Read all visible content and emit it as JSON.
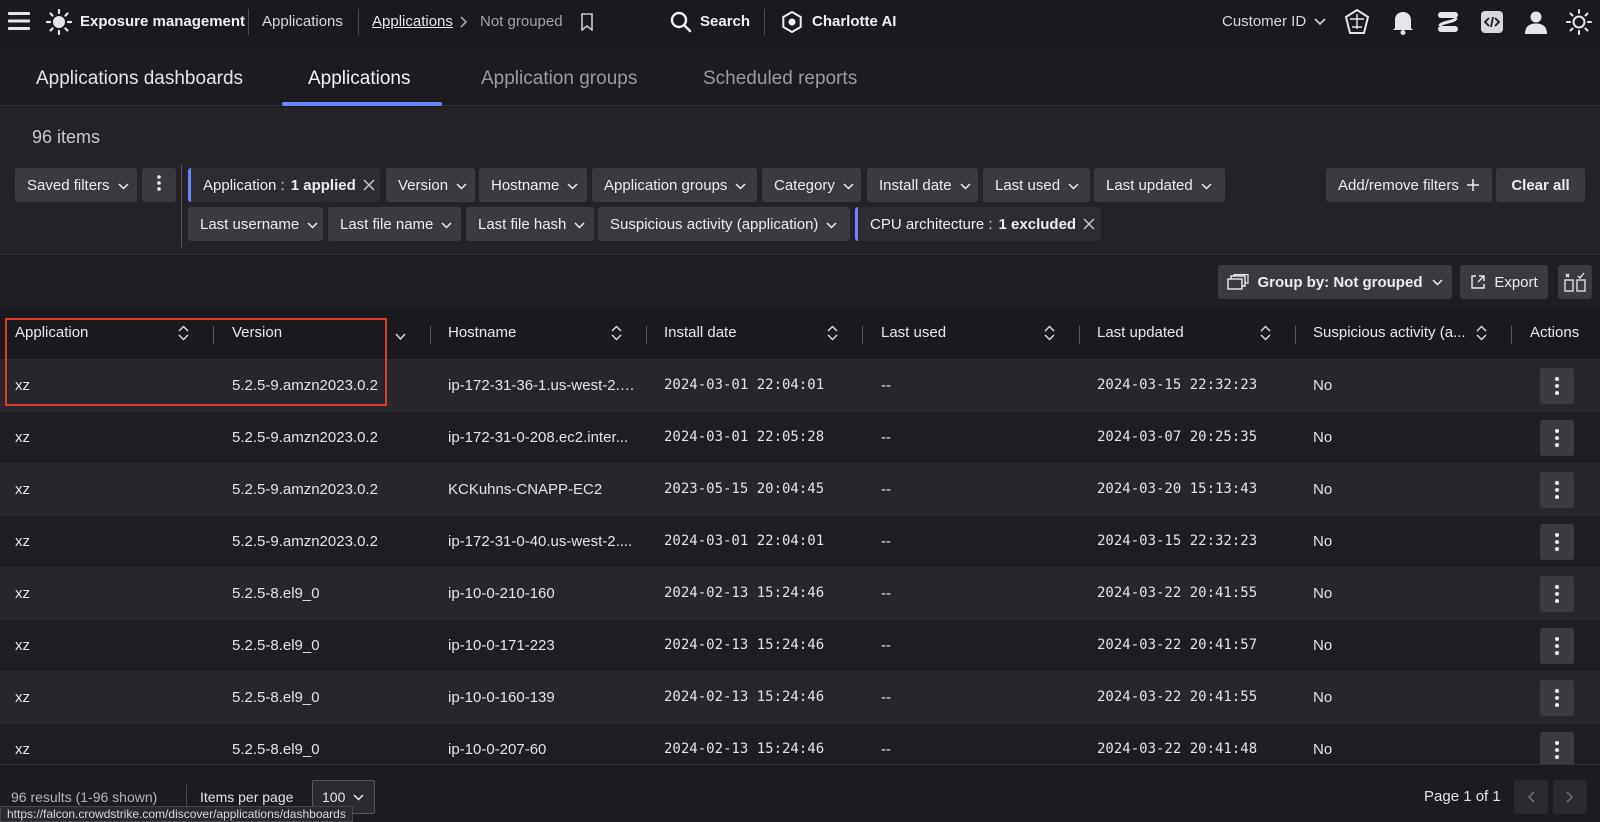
{
  "topbar": {
    "brand": "Exposure management",
    "crumbs": [
      "Applications",
      "Applications",
      "Not grouped"
    ],
    "search": "Search",
    "charlotte": "Charlotte AI",
    "customer": "Customer ID"
  },
  "tabs": [
    "Applications dashboards",
    "Applications",
    "Application groups",
    "Scheduled reports"
  ],
  "filters": {
    "count": "96 items",
    "saved": "Saved filters",
    "application_label": "Application :",
    "application_value": "1 applied",
    "row1": [
      "Version",
      "Hostname",
      "Application groups",
      "Category",
      "Install date",
      "Last used",
      "Last updated"
    ],
    "row2": [
      "Last username",
      "Last file name",
      "Last file hash",
      "Suspicious activity (application)"
    ],
    "cpu_label": "CPU architecture :",
    "cpu_value": "1 excluded",
    "add_remove": "Add/remove filters",
    "clear": "Clear all"
  },
  "toolbar": {
    "group_by": "Group by: Not grouped",
    "export": "Export"
  },
  "table": {
    "columns": [
      "Application",
      "Version",
      "Hostname",
      "Install date",
      "Last used",
      "Last updated",
      "Suspicious activity (a...",
      "Actions"
    ],
    "rows": [
      [
        "xz",
        "5.2.5-9.amzn2023.0.2",
        "ip-172-31-36-1.us-west-2.c...",
        "2024-03-01 22:04:01",
        "--",
        "2024-03-15 22:32:23",
        "No"
      ],
      [
        "xz",
        "5.2.5-9.amzn2023.0.2",
        "ip-172-31-0-208.ec2.inter...",
        "2024-03-01 22:05:28",
        "--",
        "2024-03-07 20:25:35",
        "No"
      ],
      [
        "xz",
        "5.2.5-9.amzn2023.0.2",
        "KCKuhns-CNAPP-EC2",
        "2023-05-15 20:04:45",
        "--",
        "2024-03-20 15:13:43",
        "No"
      ],
      [
        "xz",
        "5.2.5-9.amzn2023.0.2",
        "ip-172-31-0-40.us-west-2....",
        "2024-03-01 22:04:01",
        "--",
        "2024-03-15 22:32:23",
        "No"
      ],
      [
        "xz",
        "5.2.5-8.el9_0",
        "ip-10-0-210-160",
        "2024-02-13 15:24:46",
        "--",
        "2024-03-22 20:41:55",
        "No"
      ],
      [
        "xz",
        "5.2.5-8.el9_0",
        "ip-10-0-171-223",
        "2024-02-13 15:24:46",
        "--",
        "2024-03-22 20:41:57",
        "No"
      ],
      [
        "xz",
        "5.2.5-8.el9_0",
        "ip-10-0-160-139",
        "2024-02-13 15:24:46",
        "--",
        "2024-03-22 20:41:55",
        "No"
      ],
      [
        "xz",
        "5.2.5-8.el9_0",
        "ip-10-0-207-60",
        "2024-02-13 15:24:46",
        "--",
        "2024-03-22 20:41:48",
        "No"
      ]
    ]
  },
  "footer": {
    "results": "96 results (1-96 shown)",
    "items_per_page": "Items per page",
    "per_page_value": "100",
    "page": "Page 1 of 1"
  },
  "status_url": "https://falcon.crowdstrike.com/discover/applications/dashboards"
}
